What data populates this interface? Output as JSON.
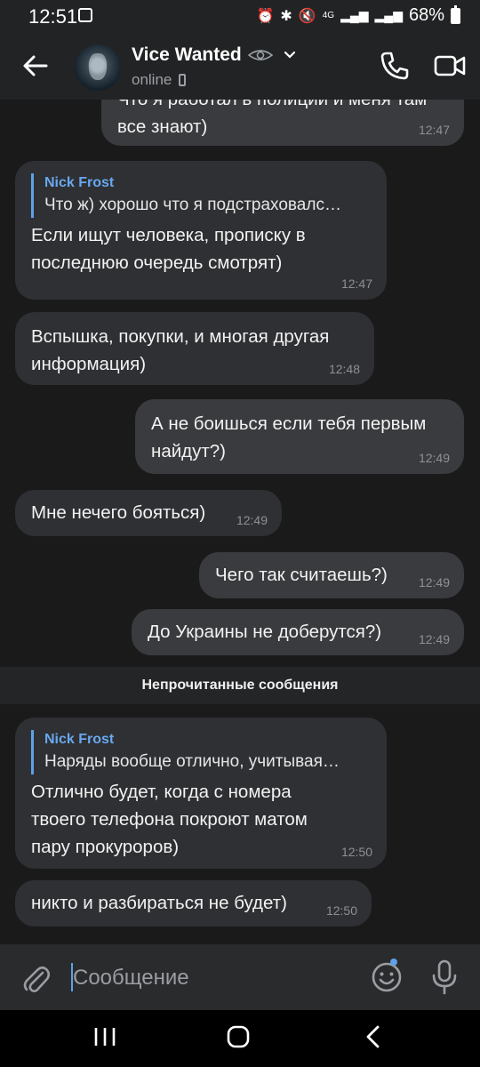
{
  "status_bar": {
    "time": "12:51",
    "network": "4G",
    "battery": "68%"
  },
  "header": {
    "contact_name": "Vice Wanted",
    "status": "online",
    "back_icon": "arrow-left-icon",
    "call_icon": "phone-icon",
    "video_icon": "video-camera-icon"
  },
  "messages": [
    {
      "direction": "out",
      "text": "Что я работал в полиции и меня там\nвсе знают)",
      "time": "12:47"
    },
    {
      "direction": "in",
      "reply": {
        "name": "Nick Frost",
        "text": "Что ж) хорошо что я подстраховалс…"
      },
      "text": "Если ищут человека, прописку в\nпоследнюю очередь смотрят)",
      "time": "12:47"
    },
    {
      "direction": "in",
      "text": "Вспышка, покупки, и многая другая\nинформация)",
      "time": "12:48"
    },
    {
      "direction": "out",
      "text": "А не боишься если тебя первым\nнайдут?)",
      "time": "12:49"
    },
    {
      "direction": "in",
      "text": "Мне нечего бояться)",
      "time": "12:49"
    },
    {
      "direction": "out",
      "text": "Чего так считаешь?)",
      "time": "12:49"
    },
    {
      "direction": "out",
      "text": "До Украины не доберутся?)",
      "time": "12:49"
    },
    {
      "direction": "in",
      "reply": {
        "name": "Nick Frost",
        "text": "Наряды вообще отлично, учитывая…"
      },
      "text": "Отлично будет, когда с номера\nтвоего телефона покроют матом\nпару прокуроров)",
      "time": "12:50"
    },
    {
      "direction": "in",
      "text": "никто и разбираться не будет)",
      "time": "12:50"
    }
  ],
  "unread_divider": "Непрочитанные сообщения",
  "composer": {
    "placeholder": "Сообщение",
    "attach_icon": "paperclip-icon",
    "emoji_icon": "emoji-icon",
    "mic_icon": "microphone-icon"
  },
  "colors": {
    "background": "#1a1a1b",
    "bubble_in": "#2f3033",
    "bubble_out": "#3a3b3e",
    "accent": "#5ea1e8"
  }
}
